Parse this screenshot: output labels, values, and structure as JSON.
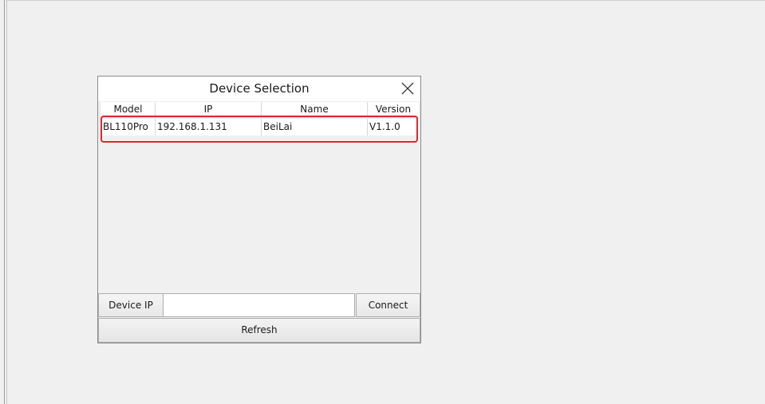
{
  "dialog": {
    "title": "Device Selection",
    "close_icon": "close-icon"
  },
  "table": {
    "columns": [
      "Model",
      "IP",
      "Name",
      "Version"
    ],
    "rows": [
      {
        "model": "BL110Pro",
        "ip": "192.168.1.131",
        "name": "BeiLai",
        "version": "V1.1.0"
      }
    ],
    "highlight_color": "#e0282e"
  },
  "connection": {
    "device_ip_label": "Device IP",
    "device_ip_value": "",
    "connect_label": "Connect",
    "refresh_label": "Refresh"
  }
}
